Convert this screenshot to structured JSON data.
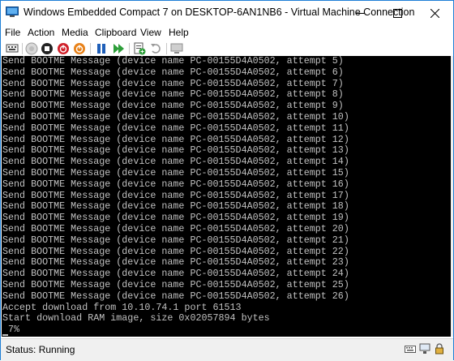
{
  "window": {
    "title": "Windows Embedded Compact 7 on DESKTOP-6AN1NB6 - Virtual Machine Connection"
  },
  "menu": {
    "items": [
      "File",
      "Action",
      "Media",
      "Clipboard",
      "View",
      "Help"
    ]
  },
  "toolbar": {
    "icons": [
      "ctrl-alt-del-icon",
      "start-icon",
      "turn-off-icon",
      "shut-down-icon",
      "save-state-icon",
      "pause-icon",
      "reset-icon",
      "checkpoint-icon",
      "revert-icon",
      "enhanced-session-icon"
    ]
  },
  "console": {
    "lines": [
      "Send BOOTME Message (device name PC-00155D4A0502, attempt 5)",
      "Send BOOTME Message (device name PC-00155D4A0502, attempt 6)",
      "Send BOOTME Message (device name PC-00155D4A0502, attempt 7)",
      "Send BOOTME Message (device name PC-00155D4A0502, attempt 8)",
      "Send BOOTME Message (device name PC-00155D4A0502, attempt 9)",
      "Send BOOTME Message (device name PC-00155D4A0502, attempt 10)",
      "Send BOOTME Message (device name PC-00155D4A0502, attempt 11)",
      "Send BOOTME Message (device name PC-00155D4A0502, attempt 12)",
      "Send BOOTME Message (device name PC-00155D4A0502, attempt 13)",
      "Send BOOTME Message (device name PC-00155D4A0502, attempt 14)",
      "Send BOOTME Message (device name PC-00155D4A0502, attempt 15)",
      "Send BOOTME Message (device name PC-00155D4A0502, attempt 16)",
      "Send BOOTME Message (device name PC-00155D4A0502, attempt 17)",
      "Send BOOTME Message (device name PC-00155D4A0502, attempt 18)",
      "Send BOOTME Message (device name PC-00155D4A0502, attempt 19)",
      "Send BOOTME Message (device name PC-00155D4A0502, attempt 20)",
      "Send BOOTME Message (device name PC-00155D4A0502, attempt 21)",
      "Send BOOTME Message (device name PC-00155D4A0502, attempt 22)",
      "Send BOOTME Message (device name PC-00155D4A0502, attempt 23)",
      "Send BOOTME Message (device name PC-00155D4A0502, attempt 24)",
      "Send BOOTME Message (device name PC-00155D4A0502, attempt 25)",
      "Send BOOTME Message (device name PC-00155D4A0502, attempt 26)",
      "Accept download from 10.10.74.1 port 61513",
      "Start download RAM image, size 0x02057894 bytes",
      " 7%"
    ]
  },
  "status": {
    "text": "Status: Running",
    "icons": [
      "keyboard-icon",
      "network-icon",
      "lock-icon"
    ]
  }
}
